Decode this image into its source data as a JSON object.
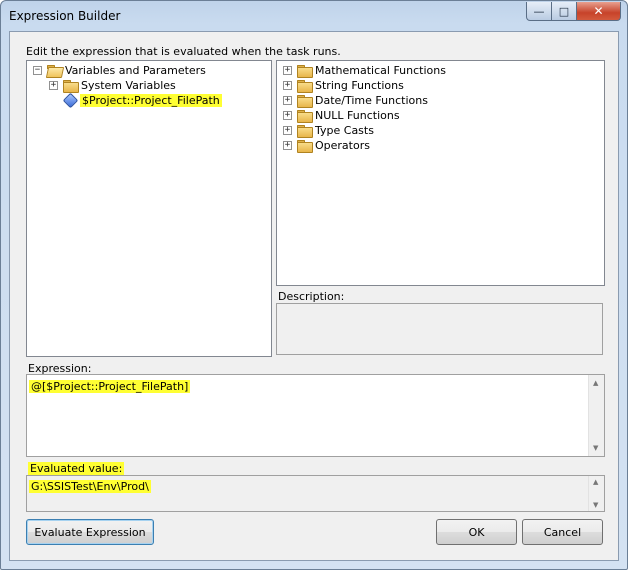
{
  "window": {
    "title": "Expression Builder"
  },
  "instructions": "Edit the expression that is evaluated when the task runs.",
  "variables_tree": {
    "root": "Variables and Parameters",
    "system_variables": "System Variables",
    "parameter": "$Project::Project_FilePath"
  },
  "functions_tree": [
    "Mathematical Functions",
    "String Functions",
    "Date/Time Functions",
    "NULL Functions",
    "Type Casts",
    "Operators"
  ],
  "description": {
    "label": "Description:",
    "text": ""
  },
  "expression": {
    "label": "Expression:",
    "value": "@[$Project::Project_FilePath]"
  },
  "evaluated": {
    "label": "Evaluated value:",
    "value": "G:\\SSISTest\\Env\\Prod\\"
  },
  "buttons": {
    "evaluate": "Evaluate Expression",
    "ok": "OK",
    "cancel": "Cancel"
  },
  "colors": {
    "highlight": "#ffff33"
  }
}
